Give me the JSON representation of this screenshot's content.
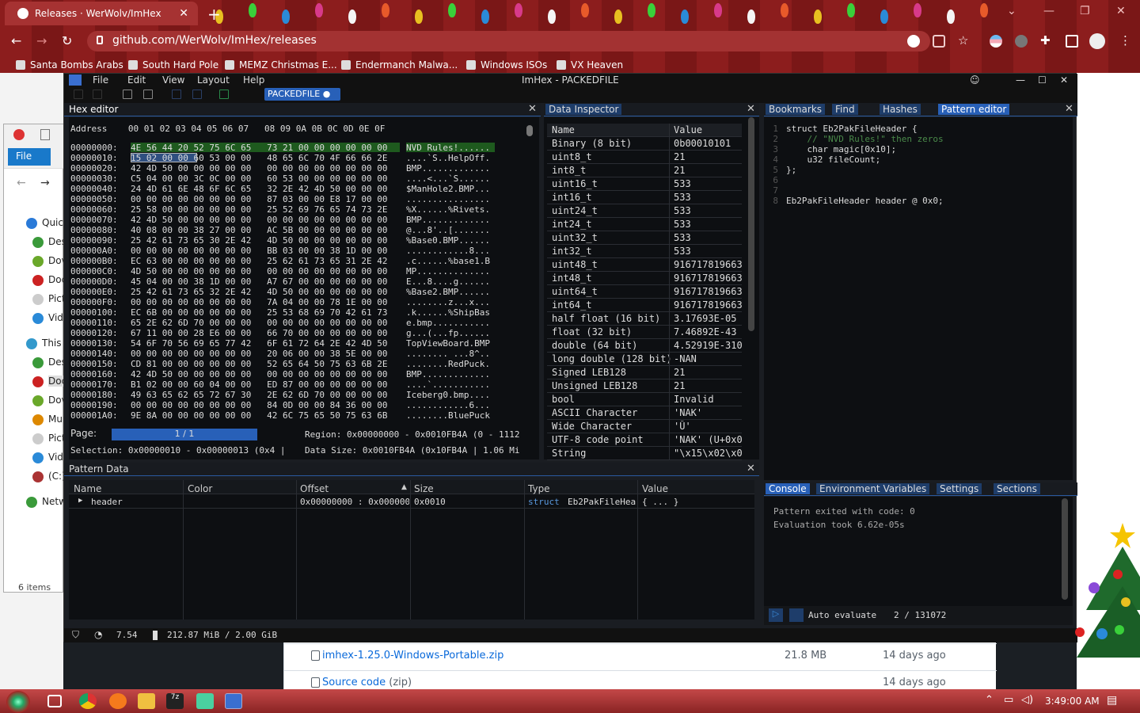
{
  "browser": {
    "tab_title": "Releases · WerWolv/ImHex",
    "url": "github.com/WerWolv/ImHex/releases",
    "bookmarks": [
      "Santa Bombs Arabs",
      "South Hard Pole",
      "MEMZ Christmas E...",
      "Endermanch Malwa...",
      "Windows ISOs",
      "VX Heaven"
    ]
  },
  "github": {
    "assets": [
      {
        "name": "imhex-1.25.0-Windows-Portable.zip",
        "size": "21.8 MB",
        "age": "14 days ago"
      },
      {
        "name": "Source code",
        "suffix": "(zip)",
        "size": "",
        "age": "14 days ago"
      }
    ]
  },
  "explorer": {
    "file_tab": "File",
    "items": [
      "Quic",
      "Des",
      "Dov",
      "Doc",
      "Pict",
      "Vid",
      "This P",
      "Des",
      "Doc",
      "Dov",
      "Mu",
      "Pict",
      "Vid",
      "(C:)",
      "Netw"
    ],
    "count": "6 items"
  },
  "imhex": {
    "title": "ImHex - PACKEDFILE",
    "menu": [
      "File",
      "Edit",
      "View",
      "Layout",
      "Help"
    ],
    "file_badge": "PACKEDFILE ●",
    "hex_editor": {
      "title": "Hex editor",
      "header": "Address    00 01 02 03 04 05 06 07   08 09 0A 0B 0C 0D 0E 0F",
      "rows": [
        {
          "adr": "00000000:",
          "b": "4E 56 44 20 52 75 6C 65   73 21 00 00 00 00 00 00",
          "a": "NVD Rules!......"
        },
        {
          "adr": "00000010:",
          "b": "15 02 00 00 60 53 00 00   48 65 6C 70 4F 66 66 2E",
          "a": "....`S..HelpOff."
        },
        {
          "adr": "00000020:",
          "b": "42 4D 50 00 00 00 00 00   00 00 00 00 00 00 00 00",
          "a": "BMP............."
        },
        {
          "adr": "00000030:",
          "b": "C5 04 00 00 3C 0C 00 00   60 53 00 00 00 00 00 00",
          "a": "....<...`S......"
        },
        {
          "adr": "00000040:",
          "b": "24 4D 61 6E 48 6F 6C 65   32 2E 42 4D 50 00 00 00",
          "a": "$ManHole2.BMP..."
        },
        {
          "adr": "00000050:",
          "b": "00 00 00 00 00 00 00 00   87 03 00 00 E8 17 00 00",
          "a": "................"
        },
        {
          "adr": "00000060:",
          "b": "25 58 00 00 00 00 00 00   25 52 69 76 65 74 73 2E",
          "a": "%X......%Rivets."
        },
        {
          "adr": "00000070:",
          "b": "42 4D 50 00 00 00 00 00   00 00 00 00 00 00 00 00",
          "a": "BMP............."
        },
        {
          "adr": "00000080:",
          "b": "40 08 00 00 38 27 00 00   AC 5B 00 00 00 00 00 00",
          "a": "@...8'..[......."
        },
        {
          "adr": "00000090:",
          "b": "25 42 61 73 65 30 2E 42   4D 50 00 00 00 00 00 00",
          "a": "%Base0.BMP......"
        },
        {
          "adr": "000000A0:",
          "b": "00 00 00 00 00 00 00 00   BB 03 00 00 38 1D 00 00",
          "a": "............8..."
        },
        {
          "adr": "000000B0:",
          "b": "EC 63 00 00 00 00 00 00   25 62 61 73 65 31 2E 42",
          "a": ".c......%base1.B"
        },
        {
          "adr": "000000C0:",
          "b": "4D 50 00 00 00 00 00 00   00 00 00 00 00 00 00 00",
          "a": "MP.............."
        },
        {
          "adr": "000000D0:",
          "b": "45 04 00 00 38 1D 00 00   A7 67 00 00 00 00 00 00",
          "a": "E...8....g......"
        },
        {
          "adr": "000000E0:",
          "b": "25 42 61 73 65 32 2E 42   4D 50 00 00 00 00 00 00",
          "a": "%Base2.BMP......"
        },
        {
          "adr": "000000F0:",
          "b": "00 00 00 00 00 00 00 00   7A 04 00 00 78 1E 00 00",
          "a": "........z...x..."
        },
        {
          "adr": "00000100:",
          "b": "EC 6B 00 00 00 00 00 00   25 53 68 69 70 42 61 73",
          "a": ".k......%ShipBas"
        },
        {
          "adr": "00000110:",
          "b": "65 2E 62 6D 70 00 00 00   00 00 00 00 00 00 00 00",
          "a": "e.bmp..........."
        },
        {
          "adr": "00000120:",
          "b": "67 11 00 00 28 E6 00 00   66 70 00 00 00 00 00 00",
          "a": "g...(...fp......"
        },
        {
          "adr": "00000130:",
          "b": "54 6F 70 56 69 65 77 42   6F 61 72 64 2E 42 4D 50",
          "a": "TopViewBoard.BMP"
        },
        {
          "adr": "00000140:",
          "b": "00 00 00 00 00 00 00 00   20 06 00 00 38 5E 00 00",
          "a": "........ ...8^.."
        },
        {
          "adr": "00000150:",
          "b": "CD 81 00 00 00 00 00 00   52 65 64 50 75 63 6B 2E",
          "a": "........RedPuck."
        },
        {
          "adr": "00000160:",
          "b": "42 4D 50 00 00 00 00 00   00 00 00 00 00 00 00 00",
          "a": "BMP............."
        },
        {
          "adr": "00000170:",
          "b": "B1 02 00 00 60 04 00 00   ED 87 00 00 00 00 00 00",
          "a": "....`..........."
        },
        {
          "adr": "00000180:",
          "b": "49 63 65 62 65 72 67 30   2E 62 6D 70 00 00 00 00",
          "a": "Iceberg0.bmp...."
        },
        {
          "adr": "00000190:",
          "b": "00 00 00 00 00 00 00 00   84 0D 00 00 84 36 00 00",
          "a": "............6..."
        },
        {
          "adr": "000001A0:",
          "b": "9E 8A 00 00 00 00 00 00   42 6C 75 65 50 75 63 6B",
          "a": "........BluePuck"
        }
      ],
      "page_label": "Page:",
      "page_value": "1 / 1",
      "region": "Region: 0x00000000 - 0x0010FB4A (0 - 1112",
      "selection": "Selection: 0x00000010 - 0x00000013 (0x4 |",
      "data_size": "Data Size: 0x0010FB4A (0x10FB4A | 1.06 Mi"
    },
    "inspector": {
      "title": "Data Inspector",
      "col_name": "Name",
      "col_value": "Value",
      "rows": [
        [
          "Binary (8 bit)",
          "0b00010101"
        ],
        [
          "uint8_t",
          "21"
        ],
        [
          "int8_t",
          "21"
        ],
        [
          "uint16_t",
          "533"
        ],
        [
          "int16_t",
          "533"
        ],
        [
          "uint24_t",
          "533"
        ],
        [
          "int24_t",
          "533"
        ],
        [
          "uint32_t",
          "533"
        ],
        [
          "int32_t",
          "533"
        ],
        [
          "uint48_t",
          "916717819663"
        ],
        [
          "int48_t",
          "916717819663"
        ],
        [
          "uint64_t",
          "916717819663"
        ],
        [
          "int64_t",
          "916717819663"
        ],
        [
          "half float (16 bit)",
          "3.17693E-05"
        ],
        [
          "float (32 bit)",
          "7.46892E-43"
        ],
        [
          "double (64 bit)",
          "4.52919E-310"
        ],
        [
          "long double (128 bit)",
          "-NAN"
        ],
        [
          "Signed LEB128",
          "21"
        ],
        [
          "Unsigned LEB128",
          "21"
        ],
        [
          "bool",
          "Invalid"
        ],
        [
          "ASCII Character",
          "'NAK'"
        ],
        [
          "Wide Character",
          "'Ȕ'"
        ],
        [
          "UTF-8 code point",
          "'NAK' (U+0x0"
        ],
        [
          "String",
          "\"\\x15\\x02\\x0"
        ]
      ]
    },
    "right_tabs": [
      "Bookmarks",
      "Find",
      "Hashes",
      "Pattern editor"
    ],
    "code": [
      "struct Eb2PakFileHeader {",
      "    // \"NVD Rules!\" then zeros",
      "    char magic[0x10];",
      "    u32 fileCount;",
      "};",
      "",
      "",
      "Eb2PakFileHeader header @ 0x0;"
    ],
    "console_tabs": [
      "Console",
      "Environment Variables",
      "Settings",
      "Sections"
    ],
    "console_lines": [
      "Pattern exited with code: 0",
      "Evaluation took 6.62e-05s"
    ],
    "auto_evaluate": "Auto evaluate",
    "eval_count": "2 / 131072",
    "pattern_data": {
      "title": "Pattern Data",
      "headers": [
        "Name",
        "Color",
        "Offset",
        "Size",
        "Type",
        "Value"
      ],
      "row": {
        "name": "header",
        "offset": "0x00000000 : 0x000000",
        "size": "0x0010",
        "type_kw": "struct",
        "type_name": "Eb2PakFileHea",
        "value": "{ ... }"
      }
    },
    "status": {
      "fps": "7.54",
      "memory": "212.87 MiB / 2.00 GiB"
    }
  },
  "taskbar": {
    "time": "3:49:00 AM"
  }
}
